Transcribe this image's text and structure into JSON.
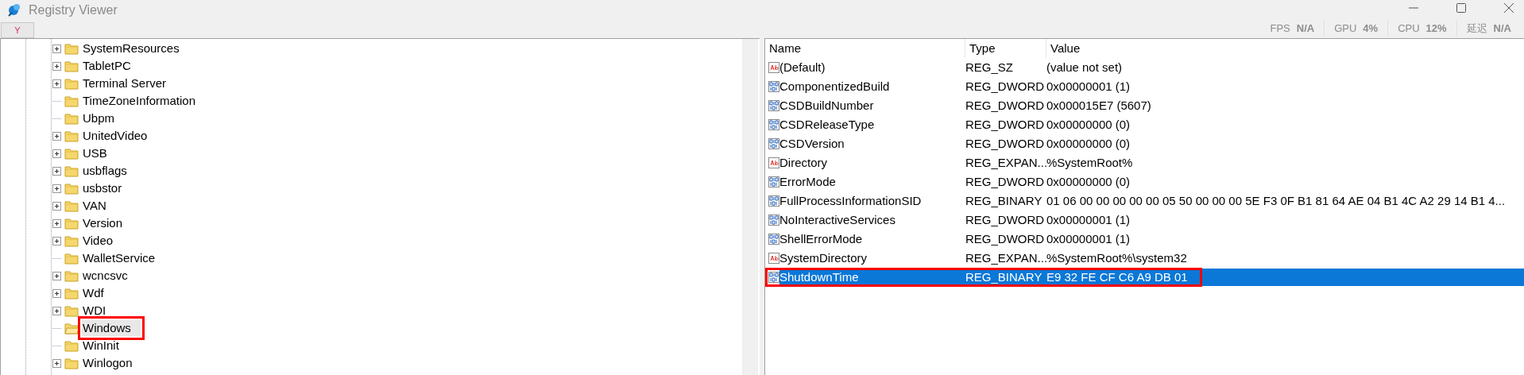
{
  "window": {
    "title": "Registry Viewer"
  },
  "overlay": [
    {
      "label": "FPS",
      "value": "N/A"
    },
    {
      "label": "GPU",
      "value": "4%"
    },
    {
      "label": "CPU",
      "value": "12%"
    },
    {
      "label": "延迟",
      "value": "N/A"
    }
  ],
  "toolbar": {
    "button": "Y"
  },
  "tree": [
    {
      "label": "SystemResources",
      "expandable": true,
      "selected": false,
      "marked": false
    },
    {
      "label": "TabletPC",
      "expandable": true,
      "selected": false,
      "marked": false
    },
    {
      "label": "Terminal Server",
      "expandable": true,
      "selected": false,
      "marked": false
    },
    {
      "label": "TimeZoneInformation",
      "expandable": false,
      "selected": false,
      "marked": false
    },
    {
      "label": "Ubpm",
      "expandable": false,
      "selected": false,
      "marked": false
    },
    {
      "label": "UnitedVideo",
      "expandable": true,
      "selected": false,
      "marked": false
    },
    {
      "label": "USB",
      "expandable": true,
      "selected": false,
      "marked": false
    },
    {
      "label": "usbflags",
      "expandable": true,
      "selected": false,
      "marked": false
    },
    {
      "label": "usbstor",
      "expandable": true,
      "selected": false,
      "marked": false
    },
    {
      "label": "VAN",
      "expandable": true,
      "selected": false,
      "marked": false
    },
    {
      "label": "Version",
      "expandable": true,
      "selected": false,
      "marked": false
    },
    {
      "label": "Video",
      "expandable": true,
      "selected": false,
      "marked": false
    },
    {
      "label": "WalletService",
      "expandable": false,
      "selected": false,
      "marked": false
    },
    {
      "label": "wcncsvc",
      "expandable": true,
      "selected": false,
      "marked": false
    },
    {
      "label": "Wdf",
      "expandable": true,
      "selected": false,
      "marked": false
    },
    {
      "label": "WDI",
      "expandable": true,
      "selected": false,
      "marked": false
    },
    {
      "label": "Windows",
      "expandable": false,
      "selected": true,
      "marked": true
    },
    {
      "label": "WinInit",
      "expandable": false,
      "selected": false,
      "marked": false
    },
    {
      "label": "Winlogon",
      "expandable": true,
      "selected": false,
      "marked": false
    }
  ],
  "table": {
    "columns": [
      "Name",
      "Type",
      "Value"
    ],
    "rows": [
      {
        "kind": "string",
        "name": "(Default)",
        "type": "REG_SZ",
        "value": "(value not set)",
        "selected": false,
        "marked": false
      },
      {
        "kind": "binary",
        "name": "ComponentizedBuild",
        "type": "REG_DWORD",
        "value": "0x00000001 (1)",
        "selected": false,
        "marked": false
      },
      {
        "kind": "binary",
        "name": "CSDBuildNumber",
        "type": "REG_DWORD",
        "value": "0x000015E7 (5607)",
        "selected": false,
        "marked": false
      },
      {
        "kind": "binary",
        "name": "CSDReleaseType",
        "type": "REG_DWORD",
        "value": "0x00000000 (0)",
        "selected": false,
        "marked": false
      },
      {
        "kind": "binary",
        "name": "CSDVersion",
        "type": "REG_DWORD",
        "value": "0x00000000 (0)",
        "selected": false,
        "marked": false
      },
      {
        "kind": "string",
        "name": "Directory",
        "type": "REG_EXPAN...",
        "value": "%SystemRoot%",
        "selected": false,
        "marked": false
      },
      {
        "kind": "binary",
        "name": "ErrorMode",
        "type": "REG_DWORD",
        "value": "0x00000000 (0)",
        "selected": false,
        "marked": false
      },
      {
        "kind": "binary",
        "name": "FullProcessInformationSID",
        "type": "REG_BINARY",
        "value": "01 06 00 00 00 00 00 05 50 00 00 00 5E F3 0F B1 81 64 AE 04 B1 4C A2 29 14 B1 4...",
        "selected": false,
        "marked": false
      },
      {
        "kind": "binary",
        "name": "NoInteractiveServices",
        "type": "REG_DWORD",
        "value": "0x00000001 (1)",
        "selected": false,
        "marked": false
      },
      {
        "kind": "binary",
        "name": "ShellErrorMode",
        "type": "REG_DWORD",
        "value": "0x00000001 (1)",
        "selected": false,
        "marked": false
      },
      {
        "kind": "string",
        "name": "SystemDirectory",
        "type": "REG_EXPAN...",
        "value": "%SystemRoot%\\system32",
        "selected": false,
        "marked": false
      },
      {
        "kind": "binary",
        "name": "ShutdownTime",
        "type": "REG_BINARY",
        "value": "E9 32 FE CF C6 A9 DB 01",
        "selected": true,
        "marked": true
      }
    ]
  }
}
